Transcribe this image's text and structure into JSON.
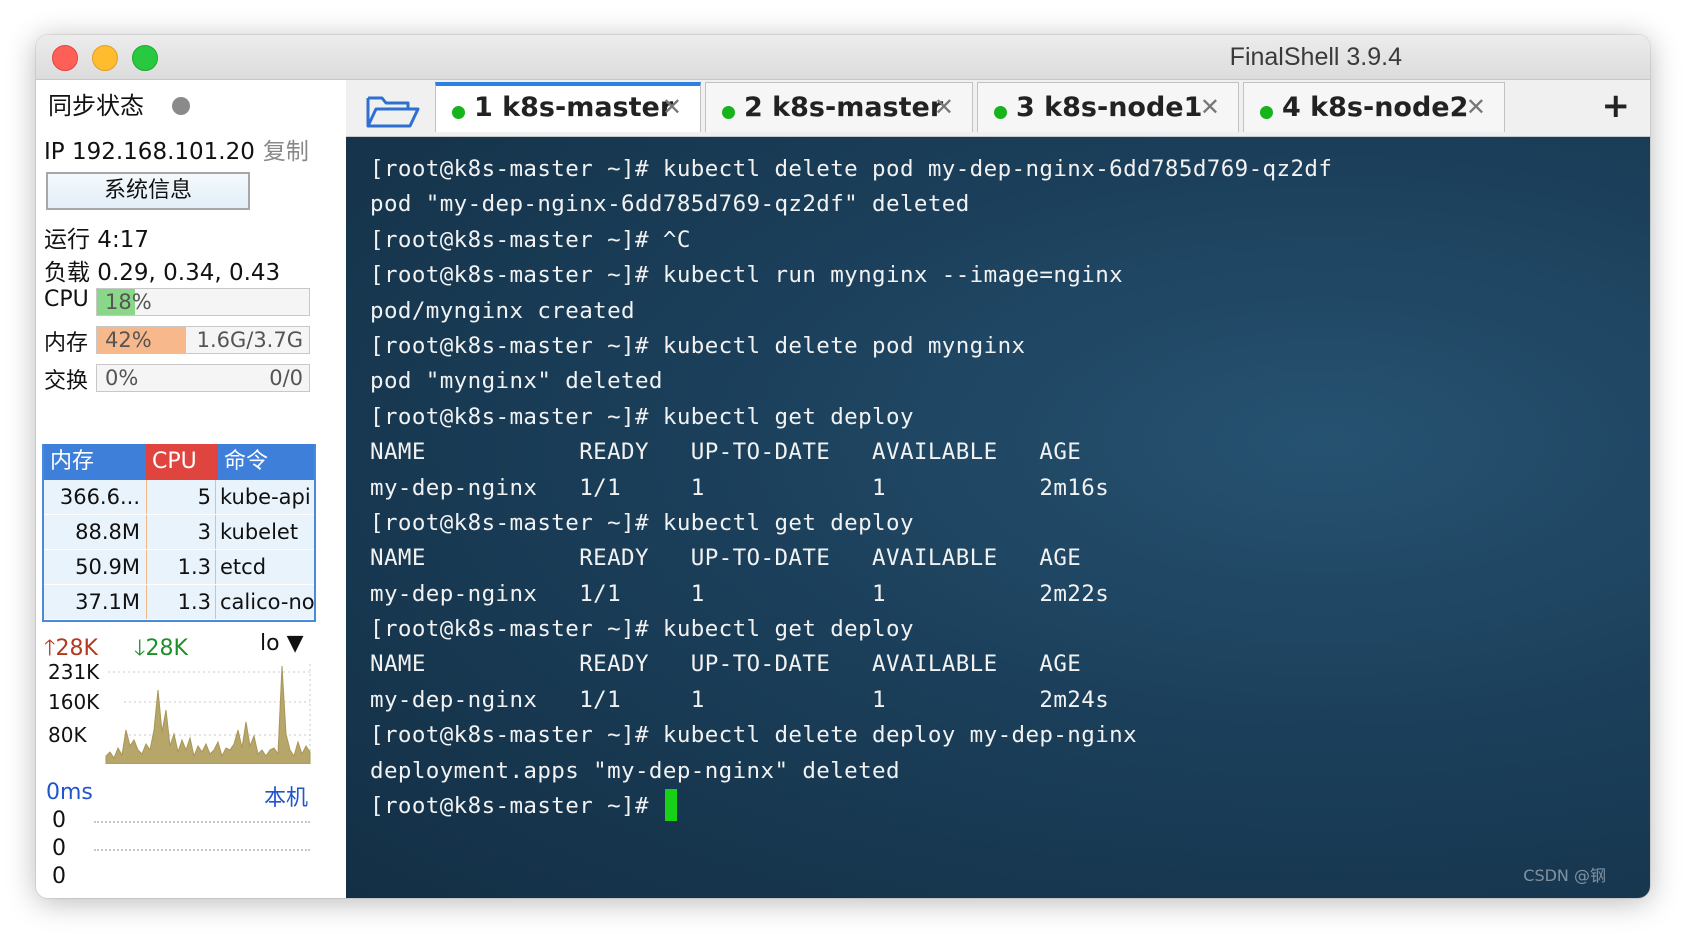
{
  "window": {
    "title": "FinalShell 3.9.4"
  },
  "sidebar": {
    "sync_label": "同步状态",
    "ip_label": "IP 192.168.101.20",
    "copy_label": "复制",
    "sysinfo_button": "系统信息",
    "uptime": "运行 4:17",
    "load": "负载 0.29, 0.34, 0.43",
    "cpu": {
      "label": "CPU",
      "value_text": "18%",
      "percent": 18,
      "color": "#8bd78a"
    },
    "memory": {
      "label": "内存",
      "value_text": "42%",
      "detail": "1.6G/3.7G",
      "percent": 42,
      "color": "#f7b98c"
    },
    "swap": {
      "label": "交换",
      "value_text": "0%",
      "detail": "0/0",
      "percent": 0
    },
    "proc_headers": {
      "mem": "内存",
      "cpu": "CPU",
      "cmd": "命令"
    },
    "processes": [
      {
        "mem": "366.6...",
        "cpu": "5",
        "cmd": "kube-api"
      },
      {
        "mem": "88.8M",
        "cpu": "3",
        "cmd": "kubelet"
      },
      {
        "mem": "50.9M",
        "cpu": "1.3",
        "cmd": "etcd"
      },
      {
        "mem": "37.1M",
        "cpu": "1.3",
        "cmd": "calico-no."
      }
    ],
    "network": {
      "up": "28K",
      "down": "28K",
      "interface": "lo",
      "scale_labels": [
        "231K",
        "160K",
        "80K"
      ]
    },
    "ping": {
      "latency": "0ms",
      "target": "本机",
      "values": [
        "0",
        "0",
        "0"
      ]
    }
  },
  "tabs": [
    {
      "label": "1  k8s-master",
      "active": true
    },
    {
      "label": "2  k8s-master",
      "active": false
    },
    {
      "label": "3  k8s-node1",
      "active": false
    },
    {
      "label": "4  k8s-node2",
      "active": false
    }
  ],
  "tab_add_label": "+",
  "terminal": {
    "lines": [
      "[root@k8s-master ~]# kubectl delete pod my-dep-nginx-6dd785d769-qz2df",
      "pod \"my-dep-nginx-6dd785d769-qz2df\" deleted",
      "[root@k8s-master ~]# ^C",
      "[root@k8s-master ~]# kubectl run mynginx --image=nginx",
      "pod/mynginx created",
      "[root@k8s-master ~]# kubectl delete pod mynginx",
      "pod \"mynginx\" deleted",
      "[root@k8s-master ~]# kubectl get deploy",
      "NAME           READY   UP-TO-DATE   AVAILABLE   AGE",
      "my-dep-nginx   1/1     1            1           2m16s",
      "[root@k8s-master ~]# kubectl get deploy",
      "NAME           READY   UP-TO-DATE   AVAILABLE   AGE",
      "my-dep-nginx   1/1     1            1           2m22s",
      "[root@k8s-master ~]# kubectl get deploy",
      "NAME           READY   UP-TO-DATE   AVAILABLE   AGE",
      "my-dep-nginx   1/1     1            1           2m24s",
      "[root@k8s-master ~]# kubectl delete deploy my-dep-nginx",
      "deployment.apps \"my-dep-nginx\" deleted",
      "[root@k8s-master ~]# "
    ],
    "cursor_color": "#17d117"
  },
  "watermark": "CSDN @钢"
}
